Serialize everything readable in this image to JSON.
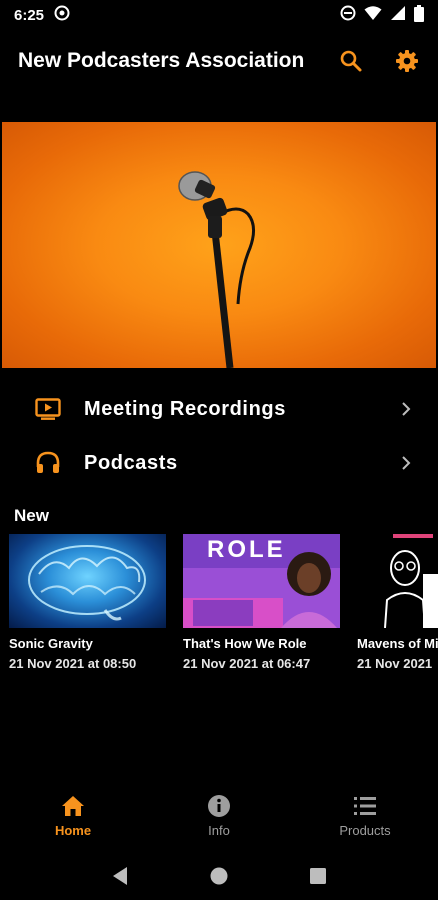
{
  "colors": {
    "accent": "#f7931e",
    "background": "#000000",
    "inactive": "#9e9e9e"
  },
  "status_bar": {
    "time": "6:25"
  },
  "app_bar": {
    "title": "New Podcasters Association",
    "search_icon": "search-icon",
    "settings_icon": "gear-icon"
  },
  "hero": {
    "image": "microphone-on-orange-background"
  },
  "menu": [
    {
      "label": "Meeting Recordings",
      "icon": "tv-play-icon"
    },
    {
      "label": "Podcasts",
      "icon": "headphones-icon"
    }
  ],
  "section": {
    "title": "New"
  },
  "cards": [
    {
      "title": "Sonic Gravity",
      "date": "21 Nov 2021 at 08:50"
    },
    {
      "title": "That's How We Role",
      "date": "21 Nov 2021 at 06:47",
      "thumb_text": "ROLE"
    },
    {
      "title": "Mavens of Mi",
      "date": "21 Nov 2021"
    }
  ],
  "bottom_nav": [
    {
      "label": "Home",
      "icon": "home-icon",
      "active": true
    },
    {
      "label": "Info",
      "icon": "info-icon",
      "active": false
    },
    {
      "label": "Products",
      "icon": "list-icon",
      "active": false
    }
  ]
}
